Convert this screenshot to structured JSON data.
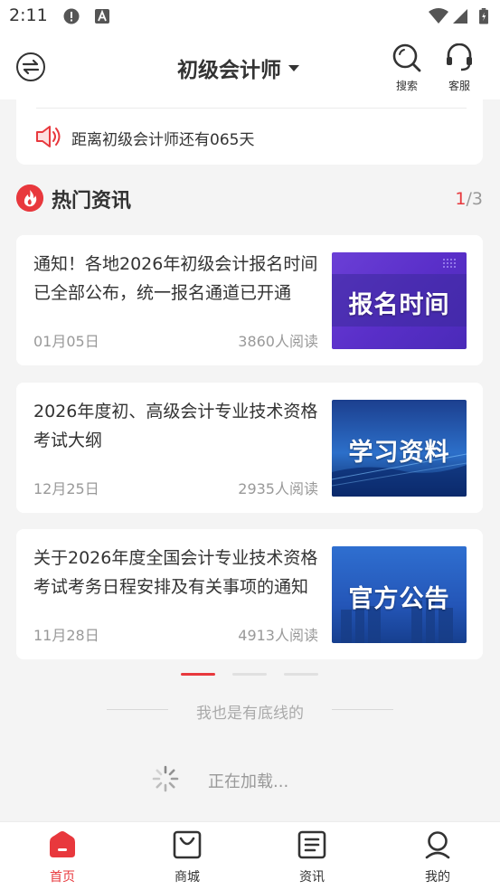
{
  "status_bar": {
    "time": "2:11"
  },
  "header": {
    "title": "初级会计师",
    "search_label": "搜索",
    "service_label": "客服"
  },
  "countdown": {
    "text": "距离初级会计师还有065天"
  },
  "hot_news": {
    "title": "热门资讯",
    "page_current": "1",
    "page_sep_total": "/3",
    "items": [
      {
        "title": "通知！各地2026年初级会计报名时间已全部公布，统一报名通道已开通",
        "date": "01月05日",
        "reads": "3860人阅读",
        "thumb_text": "报名时间"
      },
      {
        "title": "2026年度初、高级会计专业技术资格考试大纲",
        "date": "12月25日",
        "reads": "2935人阅读",
        "thumb_text": "学习资料"
      },
      {
        "title": "关于2026年度全国会计专业技术资格考试考务日程安排及有关事项的通知",
        "date": "11月28日",
        "reads": "4913人阅读",
        "thumb_text": "官方公告"
      }
    ]
  },
  "carousel": {
    "active_index": 0,
    "count": 3
  },
  "footer": {
    "bottom_text": "我也是有底线的",
    "loading_text": "正在加载..."
  },
  "tabbar": {
    "items": [
      {
        "label": "首页",
        "icon": "home-icon",
        "active": true
      },
      {
        "label": "商城",
        "icon": "shopping-bag-icon",
        "active": false
      },
      {
        "label": "资讯",
        "icon": "news-icon",
        "active": false
      },
      {
        "label": "我的",
        "icon": "profile-icon",
        "active": false
      }
    ]
  },
  "colors": {
    "accent": "#e8383d",
    "background": "#f4f4f4",
    "text": "#333333",
    "muted": "#999999"
  }
}
